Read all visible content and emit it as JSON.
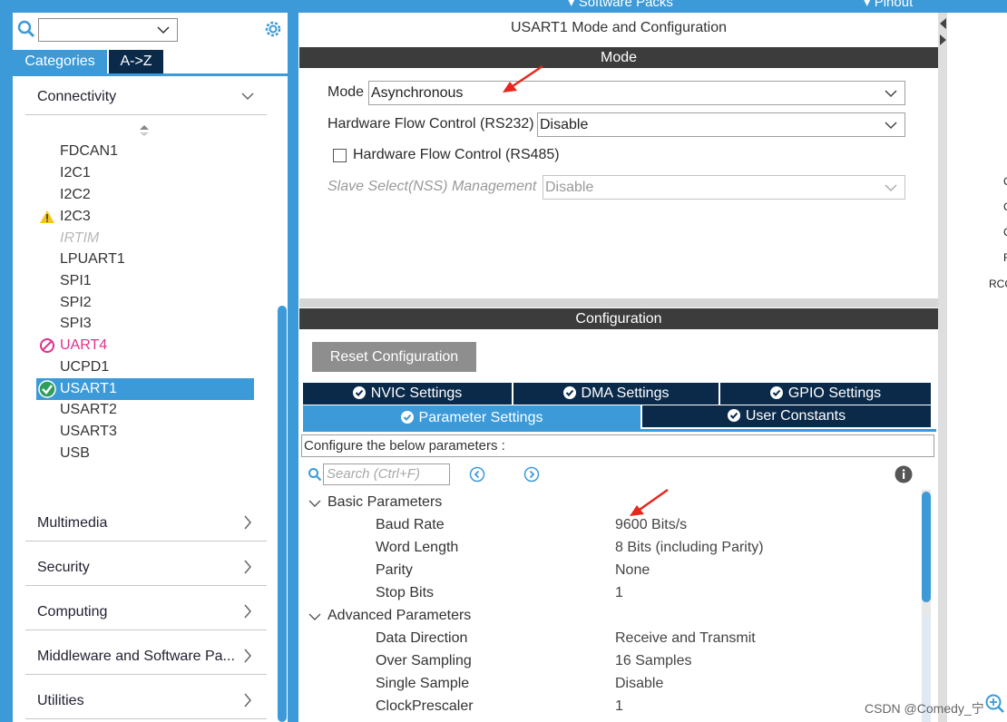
{
  "topbar": {
    "software_packs": "Software Packs",
    "pinout": "Pinout"
  },
  "left": {
    "tabs": {
      "categories": "Categories",
      "az": "A->Z"
    },
    "categories": [
      {
        "label": "Connectivity",
        "state": "expanded"
      },
      {
        "label": "Multimedia"
      },
      {
        "label": "Security"
      },
      {
        "label": "Computing"
      },
      {
        "label": "Middleware and Software Pa..."
      },
      {
        "label": "Utilities"
      }
    ],
    "peripherals": [
      {
        "label": "FDCAN1",
        "status": "none"
      },
      {
        "label": "I2C1",
        "status": "none"
      },
      {
        "label": "I2C2",
        "status": "none"
      },
      {
        "label": "I2C3",
        "status": "warning"
      },
      {
        "label": "IRTIM",
        "status": "disabled"
      },
      {
        "label": "LPUART1",
        "status": "none"
      },
      {
        "label": "SPI1",
        "status": "none"
      },
      {
        "label": "SPI2",
        "status": "none"
      },
      {
        "label": "SPI3",
        "status": "none"
      },
      {
        "label": "UART4",
        "status": "blocked"
      },
      {
        "label": "UCPD1",
        "status": "none"
      },
      {
        "label": "USART1",
        "status": "ok-selected"
      },
      {
        "label": "USART2",
        "status": "none"
      },
      {
        "label": "USART3",
        "status": "none"
      },
      {
        "label": "USB",
        "status": "none"
      }
    ]
  },
  "mid": {
    "title": "USART1 Mode and Configuration",
    "mode_header": "Mode",
    "mode": {
      "mode_label": "Mode",
      "mode_value": "Asynchronous",
      "hfc232_label": "Hardware Flow Control (RS232)",
      "hfc232_value": "Disable",
      "hfc485_label": "Hardware Flow Control (RS485)",
      "hfc485_checked": false,
      "nss_label": "Slave Select(NSS) Management",
      "nss_value": "Disable"
    },
    "config_header": "Configuration",
    "reset_button": "Reset Configuration",
    "tabs": {
      "nvic": "NVIC Settings",
      "dma": "DMA Settings",
      "gpio": "GPIO Settings",
      "params": "Parameter Settings",
      "user": "User Constants"
    },
    "config_desc": "Configure the below parameters :",
    "search_placeholder": "Search (Ctrl+F)",
    "groups": [
      {
        "name": "Basic Parameters",
        "params": [
          {
            "name": "Baud Rate",
            "value": "9600 Bits/s"
          },
          {
            "name": "Word Length",
            "value": "8 Bits (including Parity)"
          },
          {
            "name": "Parity",
            "value": "None"
          },
          {
            "name": "Stop Bits",
            "value": "1"
          }
        ]
      },
      {
        "name": "Advanced Parameters",
        "params": [
          {
            "name": "Data Direction",
            "value": "Receive and Transmit"
          },
          {
            "name": "Over Sampling",
            "value": "16 Samples"
          },
          {
            "name": "Single Sample",
            "value": "Disable"
          },
          {
            "name": "ClockPrescaler",
            "value": "1"
          }
        ]
      }
    ]
  },
  "right_partial": [
    "C",
    "C",
    "C",
    "F",
    "RCC"
  ],
  "watermark": "CSDN @Comedy_宁",
  "colors": {
    "accent": "#3c9ad8",
    "dark_tab": "#0b2a4a",
    "header_bar": "#3c3c3c",
    "ok_green": "#2e9e5b",
    "warn_yellow": "#f5c518",
    "blocked_pink": "#e0308a",
    "annotation_red": "#e8261c"
  }
}
